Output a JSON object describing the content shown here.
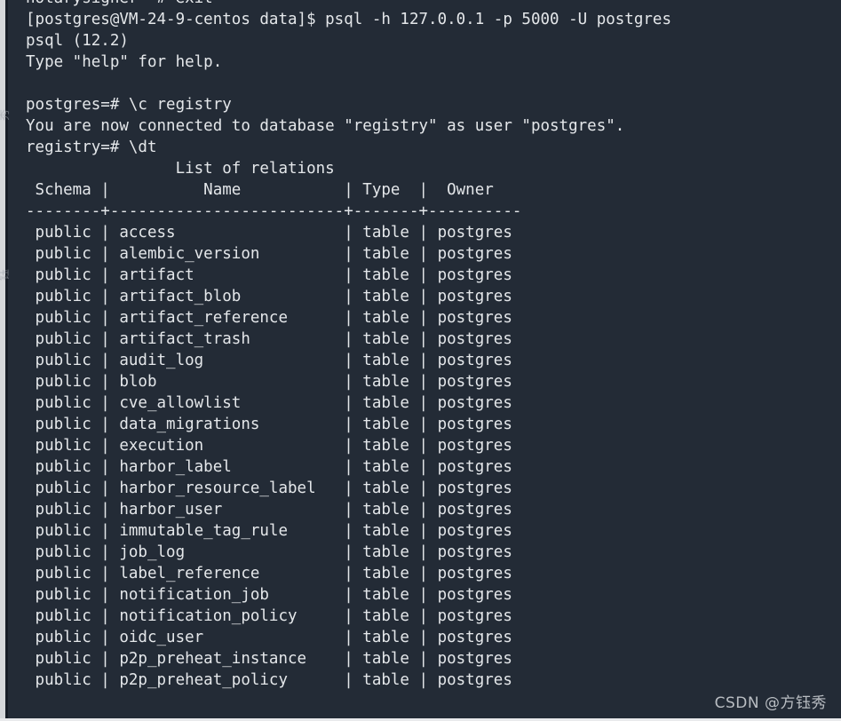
{
  "terminal": {
    "background_color": "#232b36",
    "text_color": "#e4e7ea",
    "scrollback_clipped_line": "notarysigner ~# exit",
    "lines": [
      "[postgres@VM-24-9-centos data]$ psql -h 127.0.0.1 -p 5000 -U postgres",
      "psql (12.2)",
      "Type \"help\" for help.",
      "",
      "postgres=# \\c registry",
      "You are now connected to database \"registry\" as user \"postgres\".",
      "registry=# \\dt",
      "                List of relations",
      " Schema |          Name           | Type  |  Owner   ",
      "--------+-------------------------+-------+----------",
      " public | access                  | table | postgres",
      " public | alembic_version         | table | postgres",
      " public | artifact                | table | postgres",
      " public | artifact_blob           | table | postgres",
      " public | artifact_reference      | table | postgres",
      " public | artifact_trash          | table | postgres",
      " public | audit_log               | table | postgres",
      " public | blob                    | table | postgres",
      " public | cve_allowlist           | table | postgres",
      " public | data_migrations         | table | postgres",
      " public | execution               | table | postgres",
      " public | harbor_label            | table | postgres",
      " public | harbor_resource_label   | table | postgres",
      " public | harbor_user             | table | postgres",
      " public | immutable_tag_rule      | table | postgres",
      " public | job_log                 | table | postgres",
      " public | label_reference         | table | postgres",
      " public | notification_job        | table | postgres",
      " public | notification_policy     | table | postgres",
      " public | oidc_user               | table | postgres",
      " public | p2p_preheat_instance    | table | postgres",
      " public | p2p_preheat_policy      | table | postgres"
    ]
  },
  "session": {
    "shell_prompt": "[postgres@VM-24-9-centos data]$",
    "shell_command": "psql -h 127.0.0.1 -p 5000 -U postgres",
    "psql_version_banner": "psql (12.2)",
    "psql_help_banner": "Type \"help\" for help.",
    "host": "127.0.0.1",
    "port": "5000",
    "user": "postgres",
    "hostname": "VM-24-9-centos",
    "cwd": "data",
    "prompt_before_connect": "postgres=#",
    "connect_command": "\\c registry",
    "connect_message": "You are now connected to database \"registry\" as user \"postgres\".",
    "prompt_after_connect": "registry=#",
    "list_tables_command": "\\dt"
  },
  "relations": {
    "title": "List of relations",
    "headers": [
      "Schema",
      "Name",
      "Type",
      "Owner"
    ],
    "separator": "--------+-------------------------+-------+----------",
    "rows": [
      {
        "schema": "public",
        "name": "access",
        "type": "table",
        "owner": "postgres"
      },
      {
        "schema": "public",
        "name": "alembic_version",
        "type": "table",
        "owner": "postgres"
      },
      {
        "schema": "public",
        "name": "artifact",
        "type": "table",
        "owner": "postgres"
      },
      {
        "schema": "public",
        "name": "artifact_blob",
        "type": "table",
        "owner": "postgres"
      },
      {
        "schema": "public",
        "name": "artifact_reference",
        "type": "table",
        "owner": "postgres"
      },
      {
        "schema": "public",
        "name": "artifact_trash",
        "type": "table",
        "owner": "postgres"
      },
      {
        "schema": "public",
        "name": "audit_log",
        "type": "table",
        "owner": "postgres"
      },
      {
        "schema": "public",
        "name": "blob",
        "type": "table",
        "owner": "postgres"
      },
      {
        "schema": "public",
        "name": "cve_allowlist",
        "type": "table",
        "owner": "postgres"
      },
      {
        "schema": "public",
        "name": "data_migrations",
        "type": "table",
        "owner": "postgres"
      },
      {
        "schema": "public",
        "name": "execution",
        "type": "table",
        "owner": "postgres"
      },
      {
        "schema": "public",
        "name": "harbor_label",
        "type": "table",
        "owner": "postgres"
      },
      {
        "schema": "public",
        "name": "harbor_resource_label",
        "type": "table",
        "owner": "postgres"
      },
      {
        "schema": "public",
        "name": "harbor_user",
        "type": "table",
        "owner": "postgres"
      },
      {
        "schema": "public",
        "name": "immutable_tag_rule",
        "type": "table",
        "owner": "postgres"
      },
      {
        "schema": "public",
        "name": "job_log",
        "type": "table",
        "owner": "postgres"
      },
      {
        "schema": "public",
        "name": "label_reference",
        "type": "table",
        "owner": "postgres"
      },
      {
        "schema": "public",
        "name": "notification_job",
        "type": "table",
        "owner": "postgres"
      },
      {
        "schema": "public",
        "name": "notification_policy",
        "type": "table",
        "owner": "postgres"
      },
      {
        "schema": "public",
        "name": "oidc_user",
        "type": "table",
        "owner": "postgres"
      },
      {
        "schema": "public",
        "name": "p2p_preheat_instance",
        "type": "table",
        "owner": "postgres"
      },
      {
        "schema": "public",
        "name": "p2p_preheat_policy",
        "type": "table",
        "owner": "postgres"
      }
    ]
  },
  "watermark": {
    "text": "CSDN @方钰秀",
    "edge_glyph_1": "秀",
    "edge_glyph_2": "钰"
  }
}
